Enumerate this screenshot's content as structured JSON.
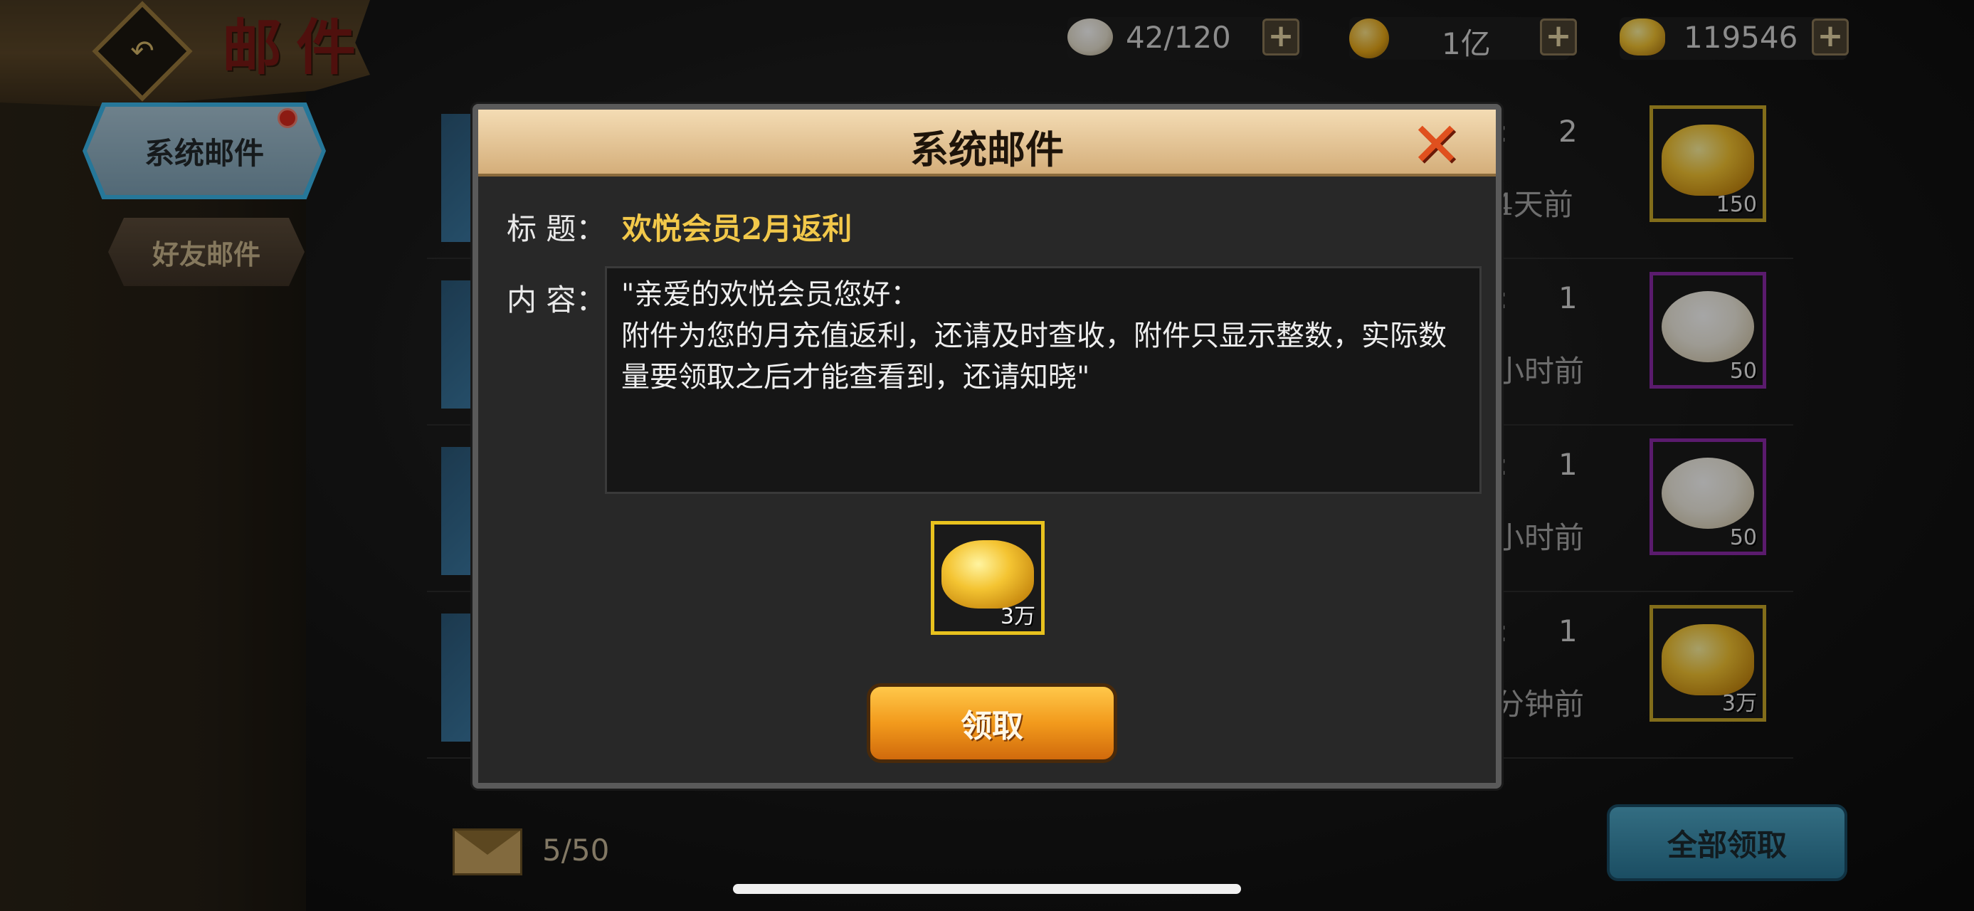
{
  "header": {
    "title": "邮件",
    "back_glyph": "↶"
  },
  "currencies": [
    {
      "icon": "bun-icon",
      "value": "42/120"
    },
    {
      "icon": "gold-coin-icon",
      "value": "1亿"
    },
    {
      "icon": "gold-ingot-icon",
      "value": "119546"
    }
  ],
  "plus_glyph": "+",
  "sidebar": {
    "tabs": [
      {
        "label": "系统邮件",
        "active": true,
        "has_notification": true
      },
      {
        "label": "好友邮件",
        "active": false
      }
    ]
  },
  "mail_list": [
    {
      "count": "2",
      "time": "4天前",
      "item": "gold-ingot",
      "amount": "150"
    },
    {
      "count": "1",
      "time": "小时前",
      "item": "bun",
      "amount": "50"
    },
    {
      "count": "1",
      "time": "小时前",
      "item": "bun",
      "amount": "50"
    },
    {
      "count": "1",
      "time": "分钟前",
      "item": "gold-ingot",
      "amount": "3万"
    }
  ],
  "list_colon": ":",
  "footer": {
    "mail_count": "5/50",
    "claim_all_label": "全部领取"
  },
  "modal": {
    "title": "系统邮件",
    "close_glyph": "✕",
    "title_label": "标 题：",
    "mail_title": "欢悦会员2月返利",
    "content_label": "内 容：",
    "content": "\"亲爱的欢悦会员您好：\n附件为您的月充值返利，还请及时查收，附件只显示整数，实际数量要领取之后才能查看到，还请知晓\"",
    "reward": {
      "item": "gold-ingot",
      "amount": "3万"
    },
    "claim_label": "领取"
  },
  "colors": {
    "accent_gold": "#f2c84a",
    "close_orange": "#e0501e",
    "tab_active_glow": "#3bb7ec",
    "notification_red": "#d82a1e"
  }
}
